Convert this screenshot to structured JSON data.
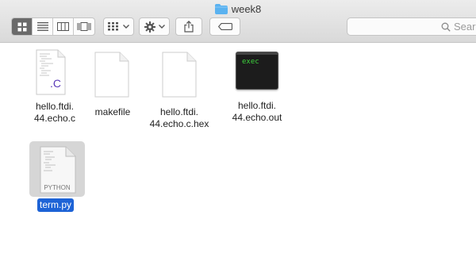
{
  "window": {
    "title": "week8",
    "icon": "folder-icon"
  },
  "toolbar": {
    "view_buttons": [
      "icon-view-icon",
      "list-view-icon",
      "column-view-icon",
      "cover-flow-icon"
    ],
    "active_view": "icon-view-icon",
    "arrange_icon": "arrange-icon",
    "action_icon": "gear-icon",
    "share_icon": "share-icon",
    "tag_icon": "tag-icon",
    "search_placeholder": "Sear"
  },
  "files": [
    {
      "name": "hello.ftdi.",
      "name2": "44.echo.c",
      "type": "c-source",
      "badge": ".C"
    },
    {
      "name": "makefile",
      "type": "blank-document"
    },
    {
      "name": "hello.ftdi.",
      "name2": "44.echo.c.hex",
      "type": "blank-document"
    },
    {
      "name": "hello.ftdi.",
      "name2": "44.echo.out",
      "type": "executable",
      "badge": "exec"
    },
    {
      "name": "term.py",
      "type": "python-script",
      "badge": "PYTHON",
      "selected": true
    }
  ],
  "colors": {
    "selection": "#1d63d6",
    "exec_text": "#3cd13c",
    "c_badge": "#5a3ab8",
    "folder": "#5ab2f0"
  }
}
